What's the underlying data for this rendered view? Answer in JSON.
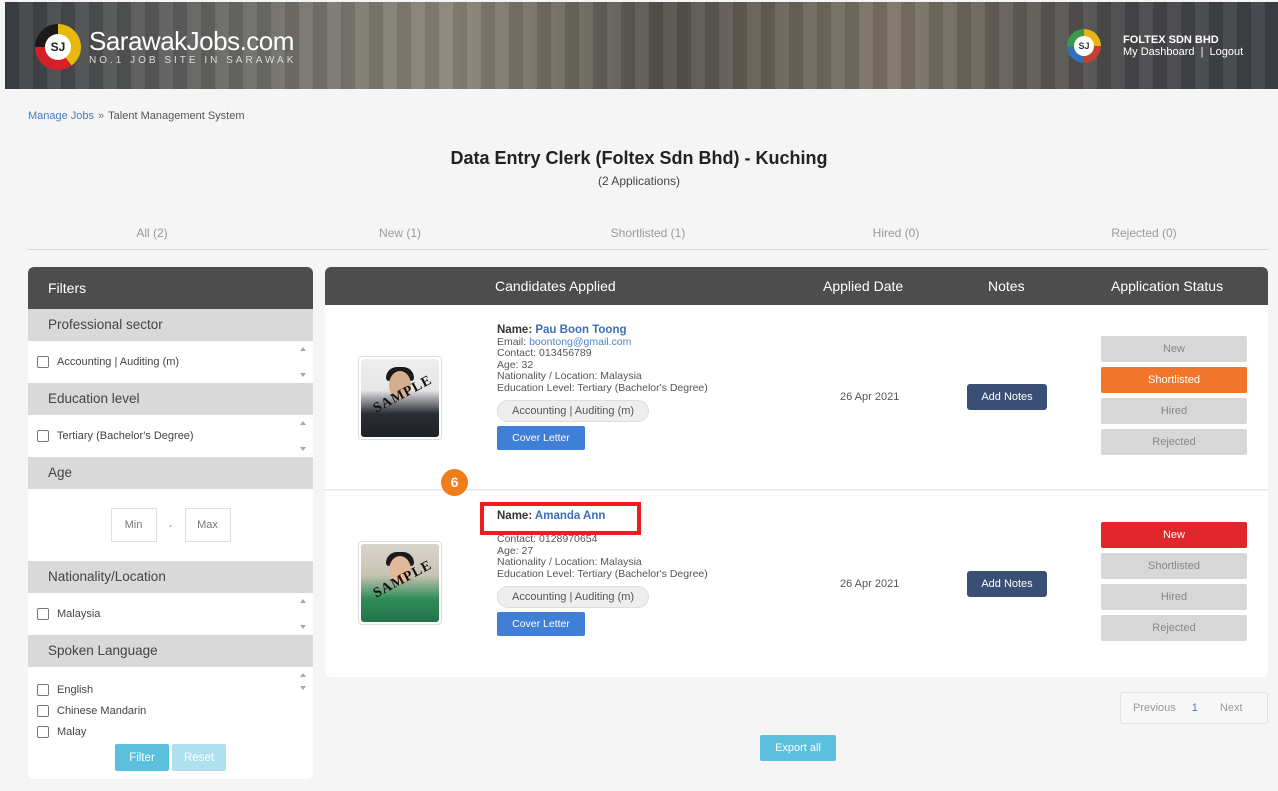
{
  "header": {
    "logo_mark": "SJ",
    "brand": "SarawakJobs.com",
    "tagline": "NO.1 JOB SITE IN SARAWAK",
    "company_name": "FOLTEX SDN BHD",
    "dashboard_link": "My Dashboard",
    "separator": "|",
    "logout_link": "Logout"
  },
  "breadcrumb": {
    "manage_jobs": "Manage Jobs",
    "separator": "»",
    "current": "Talent Management System"
  },
  "job": {
    "title": "Data Entry Clerk (Foltex Sdn Bhd) - Kuching",
    "applications": "(2 Applications)"
  },
  "tabs": [
    "All (2)",
    "New (1)",
    "Shortlisted (1)",
    "Hired (0)",
    "Rejected (0)"
  ],
  "filters": {
    "title": "Filters",
    "sections": {
      "sector": {
        "title": "Professional sector",
        "options": [
          "Accounting | Auditing (m)"
        ]
      },
      "education": {
        "title": "Education level",
        "options": [
          "Tertiary (Bachelor's Degree)"
        ]
      },
      "age": {
        "title": "Age",
        "min_placeholder": "Min",
        "dash": "-",
        "max_placeholder": "Max"
      },
      "nationality": {
        "title": "Nationality/Location",
        "options": [
          "Malaysia"
        ]
      },
      "language": {
        "title": "Spoken Language",
        "options": [
          "English",
          "Chinese Mandarin",
          "Malay"
        ]
      }
    },
    "filter_button": "Filter",
    "reset_button": "Reset"
  },
  "table": {
    "columns": [
      "Candidates Applied",
      "Applied Date",
      "Notes",
      "Application Status"
    ]
  },
  "candidates": [
    {
      "name_label": "Name: ",
      "name": "Pau Boon Toong",
      "email_label": "Email: ",
      "email": "boontong@gmail.com",
      "contact": "Contact: 013456789",
      "age": "Age: 32",
      "nationality": "Nationality / Location: Malaysia",
      "education": "Education Level: Tertiary (Bachelor's Degree)",
      "sector": "Accounting | Auditing (m)",
      "cover_letter": "Cover Letter",
      "photo_stamp": "SAMPLE",
      "applied_date": "26 Apr 2021",
      "notes_button": "Add Notes",
      "statuses": [
        "New",
        "Shortlisted",
        "Hired",
        "Rejected"
      ],
      "active_status": "Shortlisted"
    },
    {
      "name_label": "Name: ",
      "name": "Amanda Ann",
      "contact": "Contact: 0128970654",
      "age": "Age: 27",
      "nationality": "Nationality / Location: Malaysia",
      "education": "Education Level: Tertiary (Bachelor's Degree)",
      "sector": "Accounting | Auditing (m)",
      "cover_letter": "Cover Letter",
      "photo_stamp": "SAMPLE",
      "applied_date": "26 Apr 2021",
      "notes_button": "Add Notes",
      "statuses": [
        "New",
        "Shortlisted",
        "Hired",
        "Rejected"
      ],
      "active_status": "New"
    }
  ],
  "annotation": {
    "step": "6"
  },
  "pagination": {
    "previous": "Previous",
    "page": "1",
    "next": "Next"
  },
  "export_button": "Export all",
  "colors": {
    "header_dark": "#4d4d4d",
    "filter_button": "#5bc0de",
    "cover_letter": "#3f7fd5",
    "notes_button": "#3a4f74",
    "shortlisted": "#f2762a",
    "new_active": "#e0262a",
    "annotation_badge": "#f07d1c",
    "highlight_box": "#ee1c1c"
  }
}
